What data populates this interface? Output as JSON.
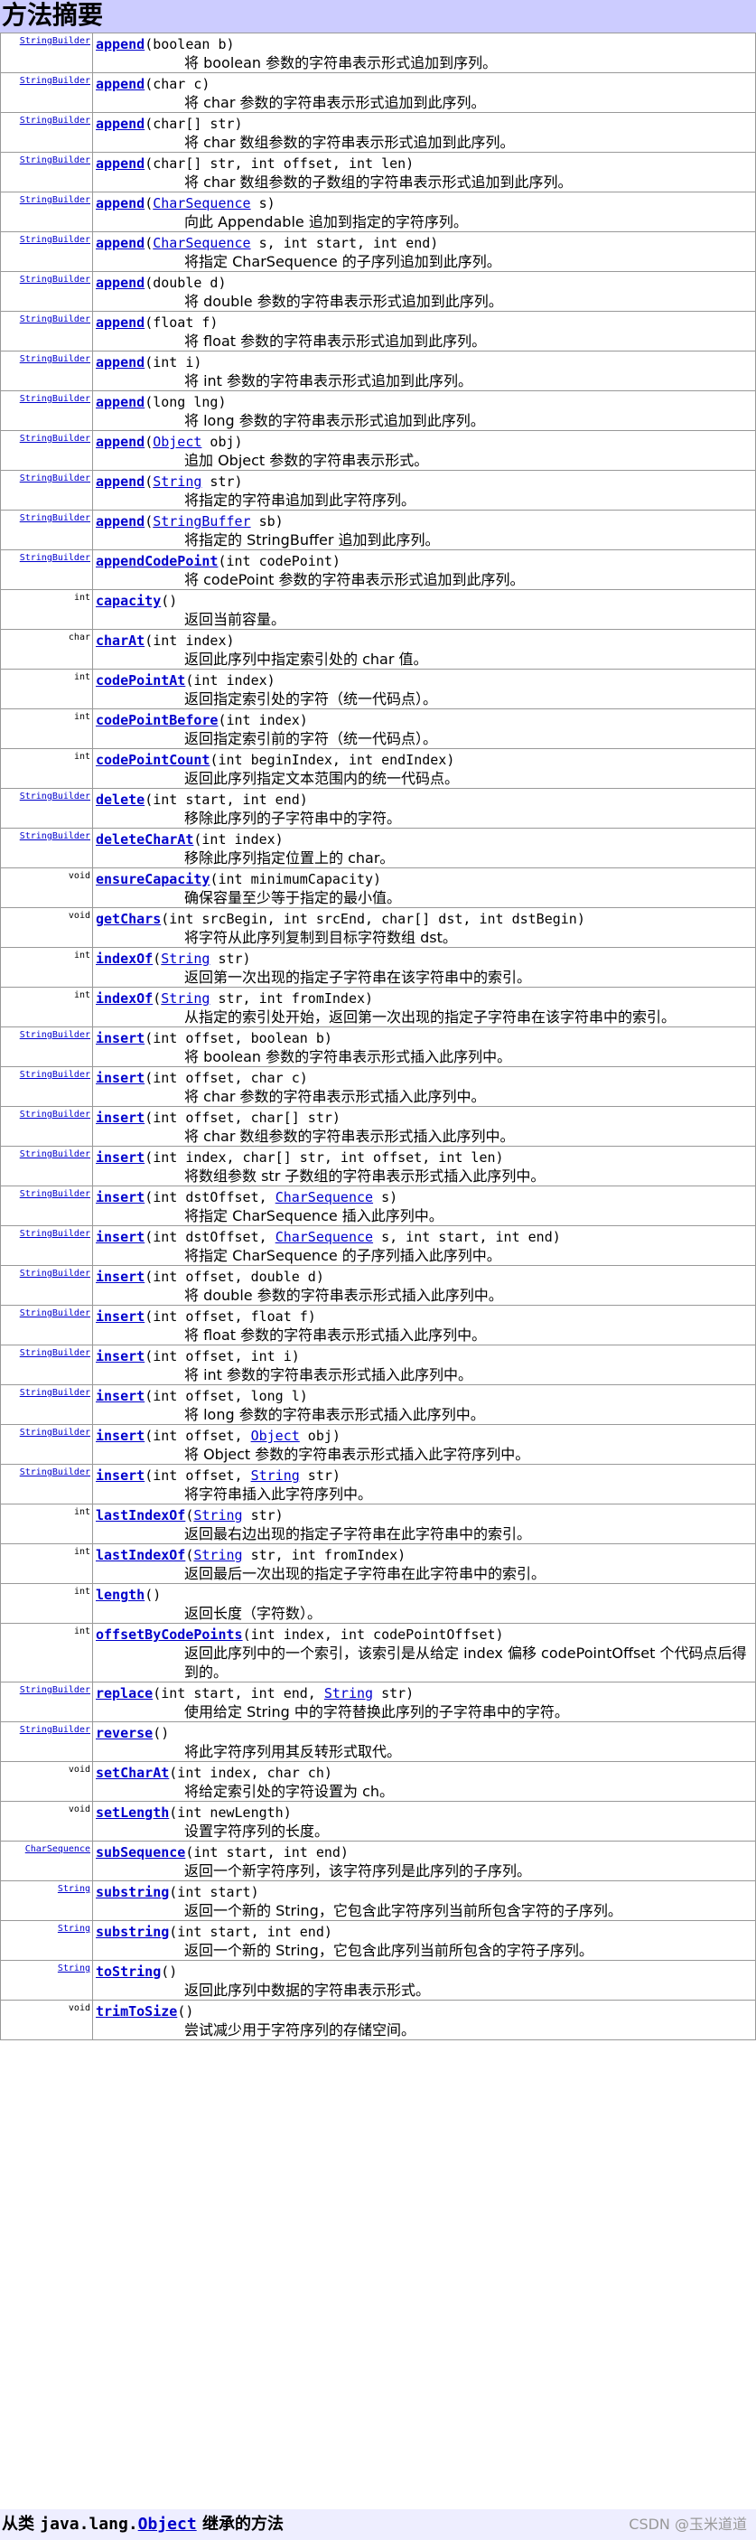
{
  "heading": "方法摘要",
  "rows": [
    {
      "ret": "StringBuilder",
      "name": "append",
      "args": [
        {
          "t": "(boolean b)"
        }
      ],
      "desc": "将 boolean 参数的字符串表示形式追加到序列。"
    },
    {
      "ret": "StringBuilder",
      "name": "append",
      "args": [
        {
          "t": "(char c)"
        }
      ],
      "desc": "将 char 参数的字符串表示形式追加到此序列。"
    },
    {
      "ret": "StringBuilder",
      "name": "append",
      "args": [
        {
          "t": "(char[] str)"
        }
      ],
      "desc": "将 char 数组参数的字符串表示形式追加到此序列。"
    },
    {
      "ret": "StringBuilder",
      "name": "append",
      "args": [
        {
          "t": "(char[] str, int offset, int len)"
        }
      ],
      "desc": "将 char 数组参数的子数组的字符串表示形式追加到此序列。"
    },
    {
      "ret": "StringBuilder",
      "name": "append",
      "args": [
        {
          "t": "("
        },
        {
          "t": "CharSequence",
          "link": true
        },
        {
          "t": " s)"
        }
      ],
      "desc": "向此 Appendable 追加到指定的字符序列。"
    },
    {
      "ret": "StringBuilder",
      "name": "append",
      "args": [
        {
          "t": "("
        },
        {
          "t": "CharSequence",
          "link": true
        },
        {
          "t": " s, int start, int end)"
        }
      ],
      "desc": "将指定 CharSequence 的子序列追加到此序列。"
    },
    {
      "ret": "StringBuilder",
      "name": "append",
      "args": [
        {
          "t": "(double d)"
        }
      ],
      "desc": "将 double 参数的字符串表示形式追加到此序列。"
    },
    {
      "ret": "StringBuilder",
      "name": "append",
      "args": [
        {
          "t": "(float f)"
        }
      ],
      "desc": "将 float 参数的字符串表示形式追加到此序列。"
    },
    {
      "ret": "StringBuilder",
      "name": "append",
      "args": [
        {
          "t": "(int i)"
        }
      ],
      "desc": "将 int 参数的字符串表示形式追加到此序列。"
    },
    {
      "ret": "StringBuilder",
      "name": "append",
      "args": [
        {
          "t": "(long lng)"
        }
      ],
      "desc": "将 long 参数的字符串表示形式追加到此序列。"
    },
    {
      "ret": "StringBuilder",
      "name": "append",
      "args": [
        {
          "t": "("
        },
        {
          "t": "Object",
          "link": true
        },
        {
          "t": " obj)"
        }
      ],
      "desc": "追加 Object 参数的字符串表示形式。"
    },
    {
      "ret": "StringBuilder",
      "name": "append",
      "args": [
        {
          "t": "("
        },
        {
          "t": "String",
          "link": true
        },
        {
          "t": " str)"
        }
      ],
      "desc": "将指定的字符串追加到此字符序列。"
    },
    {
      "ret": "StringBuilder",
      "name": "append",
      "args": [
        {
          "t": "("
        },
        {
          "t": "StringBuffer",
          "link": true
        },
        {
          "t": " sb)"
        }
      ],
      "desc": "将指定的 StringBuffer 追加到此序列。"
    },
    {
      "ret": "StringBuilder",
      "name": "appendCodePoint",
      "args": [
        {
          "t": "(int codePoint)"
        }
      ],
      "desc": "将 codePoint 参数的字符串表示形式追加到此序列。"
    },
    {
      "ret": "int",
      "name": "capacity",
      "args": [
        {
          "t": "()"
        }
      ],
      "desc": "返回当前容量。"
    },
    {
      "ret": "char",
      "name": "charAt",
      "args": [
        {
          "t": "(int index)"
        }
      ],
      "desc": "返回此序列中指定索引处的 char 值。"
    },
    {
      "ret": "int",
      "name": "codePointAt",
      "args": [
        {
          "t": "(int index)"
        }
      ],
      "desc": "返回指定索引处的字符（统一代码点）。"
    },
    {
      "ret": "int",
      "name": "codePointBefore",
      "args": [
        {
          "t": "(int index)"
        }
      ],
      "desc": "返回指定索引前的字符（统一代码点）。"
    },
    {
      "ret": "int",
      "name": "codePointCount",
      "args": [
        {
          "t": "(int beginIndex, int endIndex)"
        }
      ],
      "desc": "返回此序列指定文本范围内的统一代码点。"
    },
    {
      "ret": "StringBuilder",
      "name": "delete",
      "args": [
        {
          "t": "(int start, int end)"
        }
      ],
      "desc": "移除此序列的子字符串中的字符。"
    },
    {
      "ret": "StringBuilder",
      "name": "deleteCharAt",
      "args": [
        {
          "t": "(int index)"
        }
      ],
      "desc": "移除此序列指定位置上的 char。"
    },
    {
      "ret": "void",
      "name": "ensureCapacity",
      "args": [
        {
          "t": "(int minimumCapacity)"
        }
      ],
      "desc": "确保容量至少等于指定的最小值。"
    },
    {
      "ret": "void",
      "name": "getChars",
      "args": [
        {
          "t": "(int srcBegin, int srcEnd, char[] dst, int dstBegin)"
        }
      ],
      "desc": "将字符从此序列复制到目标字符数组 dst。"
    },
    {
      "ret": "int",
      "name": "indexOf",
      "args": [
        {
          "t": "("
        },
        {
          "t": "String",
          "link": true
        },
        {
          "t": " str)"
        }
      ],
      "desc": "返回第一次出现的指定子字符串在该字符串中的索引。"
    },
    {
      "ret": "int",
      "name": "indexOf",
      "args": [
        {
          "t": "("
        },
        {
          "t": "String",
          "link": true
        },
        {
          "t": " str, int fromIndex)"
        }
      ],
      "desc": "从指定的索引处开始，返回第一次出现的指定子字符串在该字符串中的索引。"
    },
    {
      "ret": "StringBuilder",
      "name": "insert",
      "args": [
        {
          "t": "(int offset, boolean b)"
        }
      ],
      "desc": "将 boolean 参数的字符串表示形式插入此序列中。"
    },
    {
      "ret": "StringBuilder",
      "name": "insert",
      "args": [
        {
          "t": "(int offset, char c)"
        }
      ],
      "desc": "将 char 参数的字符串表示形式插入此序列中。"
    },
    {
      "ret": "StringBuilder",
      "name": "insert",
      "args": [
        {
          "t": "(int offset, char[] str)"
        }
      ],
      "desc": "将 char 数组参数的字符串表示形式插入此序列中。"
    },
    {
      "ret": "StringBuilder",
      "name": "insert",
      "args": [
        {
          "t": "(int index, char[] str, int offset, int len)"
        }
      ],
      "desc": "将数组参数 str 子数组的字符串表示形式插入此序列中。"
    },
    {
      "ret": "StringBuilder",
      "name": "insert",
      "args": [
        {
          "t": "(int dstOffset, "
        },
        {
          "t": "CharSequence",
          "link": true
        },
        {
          "t": " s)"
        }
      ],
      "desc": "将指定 CharSequence 插入此序列中。"
    },
    {
      "ret": "StringBuilder",
      "name": "insert",
      "args": [
        {
          "t": "(int dstOffset, "
        },
        {
          "t": "CharSequence",
          "link": true
        },
        {
          "t": " s, int start, int end)"
        }
      ],
      "desc": "将指定 CharSequence 的子序列插入此序列中。"
    },
    {
      "ret": "StringBuilder",
      "name": "insert",
      "args": [
        {
          "t": "(int offset, double d)"
        }
      ],
      "desc": "将 double 参数的字符串表示形式插入此序列中。"
    },
    {
      "ret": "StringBuilder",
      "name": "insert",
      "args": [
        {
          "t": "(int offset, float f)"
        }
      ],
      "desc": "将 float 参数的字符串表示形式插入此序列中。"
    },
    {
      "ret": "StringBuilder",
      "name": "insert",
      "args": [
        {
          "t": "(int offset, int i)"
        }
      ],
      "desc": "将 int 参数的字符串表示形式插入此序列中。"
    },
    {
      "ret": "StringBuilder",
      "name": "insert",
      "args": [
        {
          "t": "(int offset, long l)"
        }
      ],
      "desc": "将 long 参数的字符串表示形式插入此序列中。"
    },
    {
      "ret": "StringBuilder",
      "name": "insert",
      "args": [
        {
          "t": "(int offset, "
        },
        {
          "t": "Object",
          "link": true
        },
        {
          "t": " obj)"
        }
      ],
      "desc": "将 Object 参数的字符串表示形式插入此字符序列中。"
    },
    {
      "ret": "StringBuilder",
      "name": "insert",
      "args": [
        {
          "t": "(int offset, "
        },
        {
          "t": "String",
          "link": true
        },
        {
          "t": " str)"
        }
      ],
      "desc": "将字符串插入此字符序列中。"
    },
    {
      "ret": "int",
      "name": "lastIndexOf",
      "args": [
        {
          "t": "("
        },
        {
          "t": "String",
          "link": true
        },
        {
          "t": " str)"
        }
      ],
      "desc": "返回最右边出现的指定子字符串在此字符串中的索引。"
    },
    {
      "ret": "int",
      "name": "lastIndexOf",
      "args": [
        {
          "t": "("
        },
        {
          "t": "String",
          "link": true
        },
        {
          "t": " str, int fromIndex)"
        }
      ],
      "desc": "返回最后一次出现的指定子字符串在此字符串中的索引。"
    },
    {
      "ret": "int",
      "name": "length",
      "args": [
        {
          "t": "()"
        }
      ],
      "desc": "返回长度（字符数）。"
    },
    {
      "ret": "int",
      "name": "offsetByCodePoints",
      "args": [
        {
          "t": "(int index, int codePointOffset)"
        }
      ],
      "desc": "返回此序列中的一个索引，该索引是从给定 index 偏移 codePointOffset 个代码点后得到的。",
      "wrap": true
    },
    {
      "ret": "StringBuilder",
      "name": "replace",
      "args": [
        {
          "t": "(int start, int end, "
        },
        {
          "t": "String",
          "link": true
        },
        {
          "t": " str)"
        }
      ],
      "desc": "使用给定 String 中的字符替换此序列的子字符串中的字符。"
    },
    {
      "ret": "StringBuilder",
      "name": "reverse",
      "args": [
        {
          "t": "()"
        }
      ],
      "desc": "将此字符序列用其反转形式取代。"
    },
    {
      "ret": "void",
      "name": "setCharAt",
      "args": [
        {
          "t": "(int index, char ch)"
        }
      ],
      "desc": "将给定索引处的字符设置为 ch。"
    },
    {
      "ret": "void",
      "name": "setLength",
      "args": [
        {
          "t": "(int newLength)"
        }
      ],
      "desc": "设置字符序列的长度。"
    },
    {
      "ret": "CharSequence",
      "name": "subSequence",
      "args": [
        {
          "t": "(int start, int end)"
        }
      ],
      "desc": "返回一个新字符序列，该字符序列是此序列的子序列。"
    },
    {
      "ret": "String",
      "name": "substring",
      "args": [
        {
          "t": "(int start)"
        }
      ],
      "desc": "返回一个新的 String，它包含此字符序列当前所包含字符的子序列。"
    },
    {
      "ret": "String",
      "name": "substring",
      "args": [
        {
          "t": "(int start, int end)"
        }
      ],
      "desc": "返回一个新的 String，它包含此序列当前所包含的字符子序列。"
    },
    {
      "ret": "String",
      "name": "toString",
      "args": [
        {
          "t": "()"
        }
      ],
      "desc": "返回此序列中数据的字符串表示形式。"
    },
    {
      "ret": "void",
      "name": "trimToSize",
      "args": [
        {
          "t": "()"
        }
      ],
      "desc": "尝试减少用于字符序列的存储空间。"
    }
  ],
  "linked_types": [
    "StringBuilder",
    "CharSequence",
    "String"
  ],
  "footer": {
    "prefix": "从类 ",
    "pkg": "java.lang.",
    "cls": "Object",
    "suffix": " 继承的方法"
  },
  "watermark": "CSDN @玉米道道",
  "colors": {
    "heading_bg": "#ccccff",
    "link": "#0000cc",
    "footer_bg": "#eeeeff",
    "border": "#999999"
  }
}
